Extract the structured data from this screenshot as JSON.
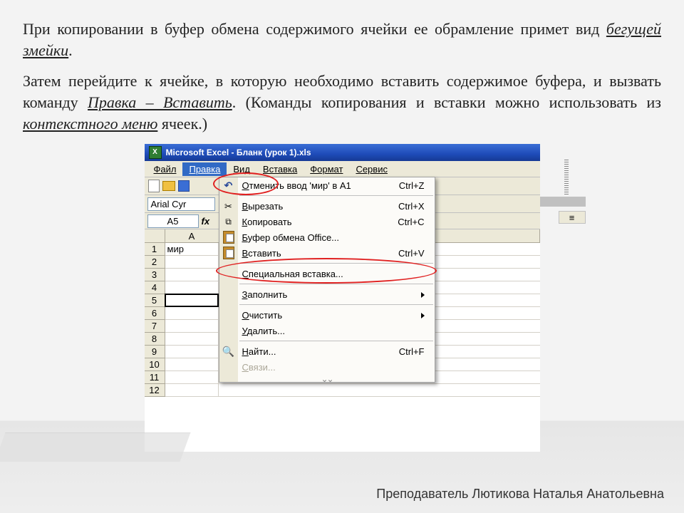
{
  "paragraph1": {
    "pre": "При копировании в буфер обмена содержимого ячейки ее обрамление примет вид ",
    "em": "бегущей змейки",
    "post": "."
  },
  "paragraph2": {
    "s1": "Затем перейдите к ячейке, в которую необходимо вставить содержимое буфера, и вызвать команду ",
    "cmd": "Правка – Вставить",
    "s2": ". (Команды копирования и вставки можно использовать из ",
    "ctx": "контекстного меню",
    "s3": " ячеек.)"
  },
  "window_title": "Microsoft Excel - Бланк (урок 1).xls",
  "menubar": [
    "Файл",
    "Правка",
    "Вид",
    "Вставка",
    "Формат",
    "Сервис"
  ],
  "menubar_selected": 1,
  "font_name": "Arial Cyr",
  "name_box": "A5",
  "grid": {
    "col_header": "A",
    "row_count": 12,
    "a1_value": "мир",
    "selected_row": 5
  },
  "menu": [
    {
      "label": "Отменить ввод 'мир' в A1",
      "shortcut": "Ctrl+Z",
      "icon": "undo"
    },
    {
      "sep": true
    },
    {
      "label": "Вырезать",
      "shortcut": "Ctrl+X",
      "icon": "cut"
    },
    {
      "label": "Копировать",
      "shortcut": "Ctrl+C",
      "icon": "copy"
    },
    {
      "label": "Буфер обмена Office...",
      "icon": "paste"
    },
    {
      "label": "Вставить",
      "shortcut": "Ctrl+V",
      "icon": "paste"
    },
    {
      "sep": true
    },
    {
      "label": "Специальная вставка..."
    },
    {
      "sep": true
    },
    {
      "label": "Заполнить",
      "submenu": true
    },
    {
      "sep": true
    },
    {
      "label": "Очистить",
      "submenu": true
    },
    {
      "label": "Удалить..."
    },
    {
      "sep": true
    },
    {
      "label": "Найти...",
      "shortcut": "Ctrl+F",
      "icon": "find"
    },
    {
      "label": "Связи...",
      "disabled": true
    }
  ],
  "right_label": "≡",
  "footer": "Преподаватель Лютикова Наталья Анатольевна"
}
